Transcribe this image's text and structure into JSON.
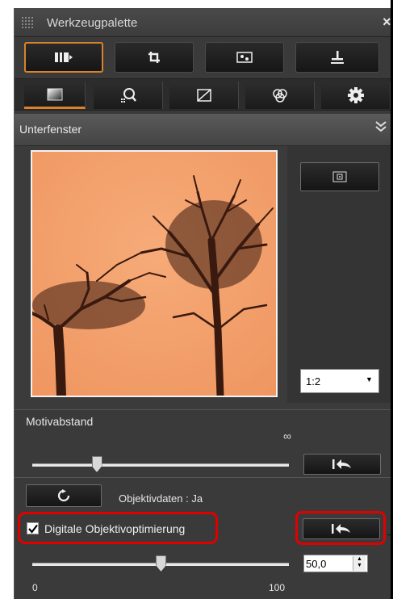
{
  "window": {
    "title": "Werkzeugpalette",
    "close_label": "×"
  },
  "tool_tabs": [
    {
      "name": "basic-adjustment",
      "icon": "basic-adjustment-icon",
      "selected": true
    },
    {
      "name": "trim",
      "icon": "crop-icon",
      "selected": false
    },
    {
      "name": "image",
      "icon": "image-icon",
      "selected": false
    },
    {
      "name": "stamp",
      "icon": "stamp-icon",
      "selected": false
    }
  ],
  "sub_tabs": [
    {
      "name": "tone",
      "icon": "gradient-icon",
      "selected": true
    },
    {
      "name": "detail",
      "icon": "magnifier-icon",
      "selected": false
    },
    {
      "name": "curve",
      "icon": "curve-icon",
      "selected": false
    },
    {
      "name": "color",
      "icon": "color-circles-icon",
      "selected": false
    },
    {
      "name": "settings",
      "icon": "gear-icon",
      "selected": false
    }
  ],
  "subwindow": {
    "title": "Unterfenster",
    "collapse_icon": "double-chevron-down-icon",
    "zoom": "1:2",
    "fit_button_icon": "fit-frame-icon"
  },
  "motiv": {
    "label": "Motivabstand",
    "far_label": "∞",
    "slider_value": 0.25,
    "reset_icon": "reset-arrow-icon"
  },
  "lens": {
    "refresh_icon": "refresh-icon",
    "lens_data_text": "Objektivdaten : Ja",
    "checkbox_label": "Digitale Objektivoptimierung",
    "checked": true,
    "value": "50,0",
    "slider_value": 0.5,
    "min_label": "0",
    "max_label": "100"
  },
  "colors": {
    "accent": "#d9822b",
    "highlight": "#e00000",
    "preview_bg": "#f3a16e"
  }
}
